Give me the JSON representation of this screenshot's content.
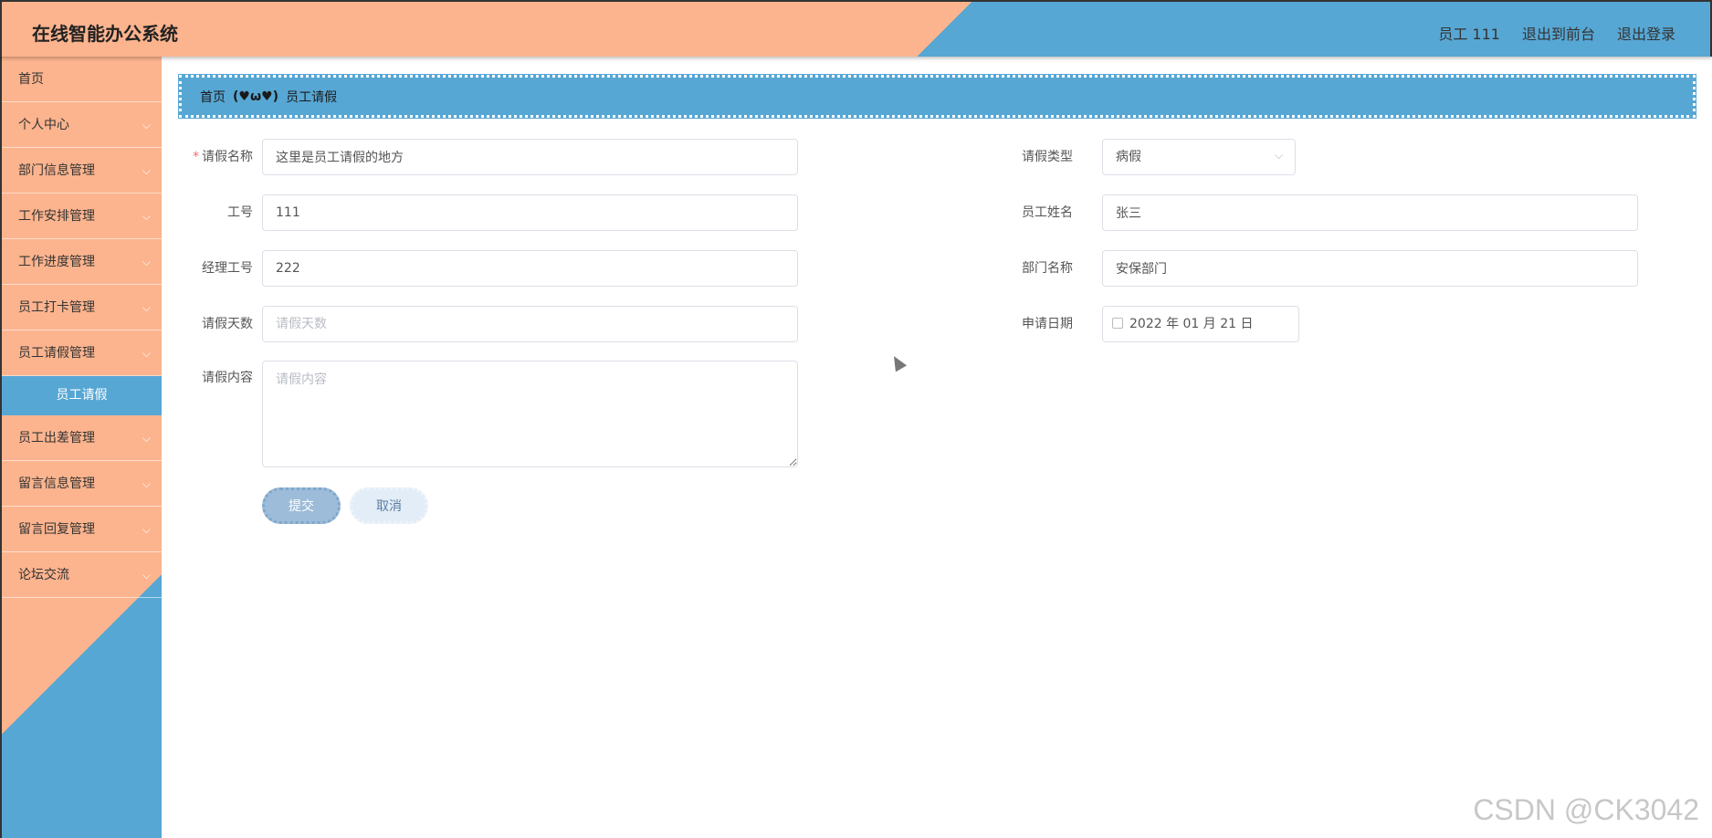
{
  "header": {
    "title": "在线智能办公系统",
    "user": "员工 111",
    "back_to_front": "退出到前台",
    "logout": "退出登录"
  },
  "sidebar": {
    "items": [
      {
        "label": "首页",
        "has_children": false
      },
      {
        "label": "个人中心",
        "has_children": true
      },
      {
        "label": "部门信息管理",
        "has_children": true
      },
      {
        "label": "工作安排管理",
        "has_children": true
      },
      {
        "label": "工作进度管理",
        "has_children": true
      },
      {
        "label": "员工打卡管理",
        "has_children": true
      },
      {
        "label": "员工请假管理",
        "has_children": true,
        "expanded": true
      },
      {
        "label": "员工出差管理",
        "has_children": true
      },
      {
        "label": "留言信息管理",
        "has_children": true
      },
      {
        "label": "留言回复管理",
        "has_children": true
      },
      {
        "label": "论坛交流",
        "has_children": true
      }
    ],
    "active_subitem": "员工请假"
  },
  "breadcrumb": {
    "home": "首页",
    "separator": "(♥ω♥)",
    "current": "员工请假"
  },
  "form": {
    "leave_name": {
      "label": "请假名称",
      "required": true,
      "value": "这里是员工请假的地方"
    },
    "leave_type": {
      "label": "请假类型",
      "value": "病假"
    },
    "emp_no": {
      "label": "工号",
      "value": "111"
    },
    "emp_name": {
      "label": "员工姓名",
      "value": "张三"
    },
    "manager_no": {
      "label": "经理工号",
      "value": "222"
    },
    "dept_name": {
      "label": "部门名称",
      "value": "安保部门"
    },
    "leave_days": {
      "label": "请假天数",
      "value": "",
      "placeholder": "请假天数"
    },
    "apply_date": {
      "label": "申请日期",
      "value": "2022 年 01 月 21 日"
    },
    "leave_content": {
      "label": "请假内容",
      "value": "",
      "placeholder": "请假内容"
    },
    "submit_label": "提交",
    "cancel_label": "取消"
  },
  "watermark": "CSDN @CK3042",
  "colors": {
    "accent_orange": "#fcb48e",
    "accent_blue": "#57a7d4"
  }
}
